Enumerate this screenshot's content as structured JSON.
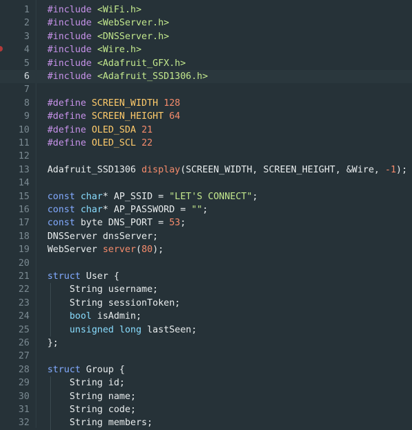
{
  "editor": {
    "active_line": 6,
    "lines": [
      {
        "n": "1",
        "tokens": [
          {
            "c": "pp",
            "t": "#include "
          },
          {
            "c": "inc",
            "t": "<WiFi.h>"
          }
        ]
      },
      {
        "n": "2",
        "tokens": [
          {
            "c": "pp",
            "t": "#include "
          },
          {
            "c": "inc",
            "t": "<WebServer.h>"
          }
        ]
      },
      {
        "n": "3",
        "tokens": [
          {
            "c": "pp",
            "t": "#include "
          },
          {
            "c": "inc",
            "t": "<DNSServer.h>"
          }
        ]
      },
      {
        "n": "4",
        "tokens": [
          {
            "c": "pp",
            "t": "#include "
          },
          {
            "c": "inc",
            "t": "<Wire.h>"
          }
        ]
      },
      {
        "n": "5",
        "tokens": [
          {
            "c": "pp",
            "t": "#include "
          },
          {
            "c": "inc",
            "t": "<Adafruit_GFX.h>"
          }
        ]
      },
      {
        "n": "6",
        "tokens": [
          {
            "c": "pp",
            "t": "#include "
          },
          {
            "c": "inc",
            "t": "<Adafruit_SSD1306.h>"
          }
        ]
      },
      {
        "n": "7",
        "tokens": []
      },
      {
        "n": "8",
        "tokens": [
          {
            "c": "pp",
            "t": "#define "
          },
          {
            "c": "def",
            "t": "SCREEN_WIDTH"
          },
          {
            "c": "plain",
            "t": " "
          },
          {
            "c": "num",
            "t": "128"
          }
        ]
      },
      {
        "n": "9",
        "tokens": [
          {
            "c": "pp",
            "t": "#define "
          },
          {
            "c": "def",
            "t": "SCREEN_HEIGHT"
          },
          {
            "c": "plain",
            "t": " "
          },
          {
            "c": "num",
            "t": "64"
          }
        ]
      },
      {
        "n": "10",
        "tokens": [
          {
            "c": "pp",
            "t": "#define "
          },
          {
            "c": "def",
            "t": "OLED_SDA"
          },
          {
            "c": "plain",
            "t": " "
          },
          {
            "c": "num",
            "t": "21"
          }
        ]
      },
      {
        "n": "11",
        "tokens": [
          {
            "c": "pp",
            "t": "#define "
          },
          {
            "c": "def",
            "t": "OLED_SCL"
          },
          {
            "c": "plain",
            "t": " "
          },
          {
            "c": "num",
            "t": "22"
          }
        ]
      },
      {
        "n": "12",
        "tokens": []
      },
      {
        "n": "13",
        "tokens": [
          {
            "c": "plain",
            "t": "Adafruit_SSD1306 "
          },
          {
            "c": "fn",
            "t": "display"
          },
          {
            "c": "plain",
            "t": "(SCREEN_WIDTH, SCREEN_HEIGHT, &Wire, "
          },
          {
            "c": "num",
            "t": "-1"
          },
          {
            "c": "plain",
            "t": ");"
          }
        ]
      },
      {
        "n": "14",
        "tokens": []
      },
      {
        "n": "15",
        "tokens": [
          {
            "c": "kw",
            "t": "const"
          },
          {
            "c": "plain",
            "t": " "
          },
          {
            "c": "type",
            "t": "char"
          },
          {
            "c": "plain",
            "t": "* AP_SSID = "
          },
          {
            "c": "str",
            "t": "\"LET'S CONNECT\""
          },
          {
            "c": "plain",
            "t": ";"
          }
        ]
      },
      {
        "n": "16",
        "tokens": [
          {
            "c": "kw",
            "t": "const"
          },
          {
            "c": "plain",
            "t": " "
          },
          {
            "c": "type",
            "t": "char"
          },
          {
            "c": "plain",
            "t": "* AP_PASSWORD = "
          },
          {
            "c": "str",
            "t": "\"\""
          },
          {
            "c": "plain",
            "t": ";"
          }
        ]
      },
      {
        "n": "17",
        "tokens": [
          {
            "c": "kw",
            "t": "const"
          },
          {
            "c": "plain",
            "t": " byte DNS_PORT = "
          },
          {
            "c": "num",
            "t": "53"
          },
          {
            "c": "plain",
            "t": ";"
          }
        ]
      },
      {
        "n": "18",
        "tokens": [
          {
            "c": "plain",
            "t": "DNSServer dnsServer;"
          }
        ]
      },
      {
        "n": "19",
        "tokens": [
          {
            "c": "plain",
            "t": "WebServer "
          },
          {
            "c": "fn",
            "t": "server"
          },
          {
            "c": "plain",
            "t": "("
          },
          {
            "c": "num",
            "t": "80"
          },
          {
            "c": "plain",
            "t": ");"
          }
        ]
      },
      {
        "n": "20",
        "tokens": []
      },
      {
        "n": "21",
        "tokens": [
          {
            "c": "kw",
            "t": "struct"
          },
          {
            "c": "plain",
            "t": " User {"
          }
        ]
      },
      {
        "n": "22",
        "tokens": [
          {
            "c": "plain",
            "t": "    String username;"
          }
        ]
      },
      {
        "n": "23",
        "tokens": [
          {
            "c": "plain",
            "t": "    String sessionToken;"
          }
        ]
      },
      {
        "n": "24",
        "tokens": [
          {
            "c": "plain",
            "t": "    "
          },
          {
            "c": "type",
            "t": "bool"
          },
          {
            "c": "plain",
            "t": " isAdmin;"
          }
        ]
      },
      {
        "n": "25",
        "tokens": [
          {
            "c": "plain",
            "t": "    "
          },
          {
            "c": "type",
            "t": "unsigned"
          },
          {
            "c": "plain",
            "t": " "
          },
          {
            "c": "type",
            "t": "long"
          },
          {
            "c": "plain",
            "t": " lastSeen;"
          }
        ]
      },
      {
        "n": "26",
        "tokens": [
          {
            "c": "plain",
            "t": "};"
          }
        ]
      },
      {
        "n": "27",
        "tokens": []
      },
      {
        "n": "28",
        "tokens": [
          {
            "c": "kw",
            "t": "struct"
          },
          {
            "c": "plain",
            "t": " Group {"
          }
        ]
      },
      {
        "n": "29",
        "tokens": [
          {
            "c": "plain",
            "t": "    String id;"
          }
        ]
      },
      {
        "n": "30",
        "tokens": [
          {
            "c": "plain",
            "t": "    String name;"
          }
        ]
      },
      {
        "n": "31",
        "tokens": [
          {
            "c": "plain",
            "t": "    String code;"
          }
        ]
      },
      {
        "n": "32",
        "tokens": [
          {
            "c": "plain",
            "t": "    String members;"
          }
        ]
      }
    ]
  }
}
